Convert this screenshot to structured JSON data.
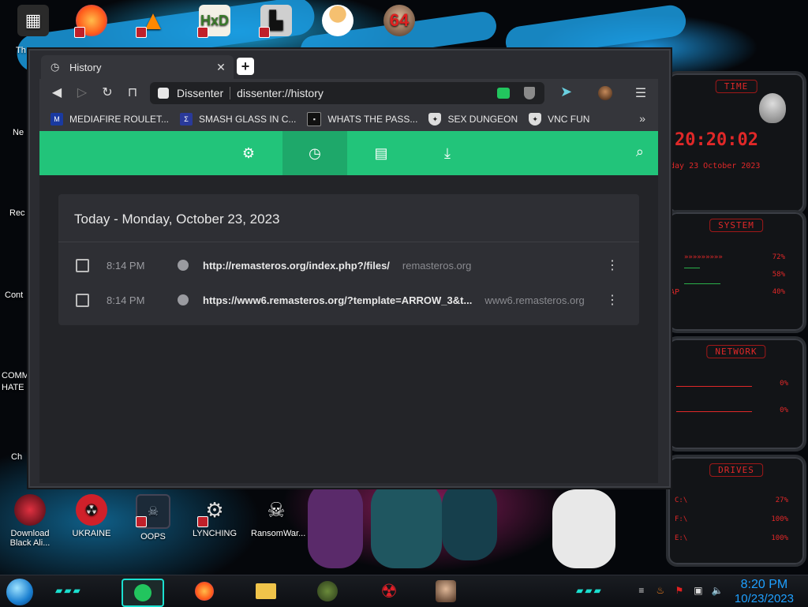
{
  "desktop": {
    "top_icons": [
      {
        "name": "tiles",
        "color": "#c0392b"
      },
      {
        "name": "firefox",
        "color": "#ff7a1a"
      },
      {
        "name": "vlc",
        "color": "#ff8800"
      },
      {
        "name": "hxd",
        "color": "#6ab04c"
      },
      {
        "name": "maze",
        "color": "#222222"
      },
      {
        "name": "doctor",
        "color": "#f0a030"
      },
      {
        "name": "portrait-64",
        "color": "#b08060"
      }
    ],
    "partial_labels": [
      "Th",
      "Ne",
      "Rec",
      "Cont",
      "COMM",
      "HATE",
      "Ch"
    ],
    "bottom_icons": [
      {
        "label": "Download Black Ali...",
        "color": "#8a1020"
      },
      {
        "label": "UKRAINE",
        "color": "#d0202a"
      },
      {
        "label": "OOPS",
        "color": "#203040"
      },
      {
        "label": "LYNCHING",
        "color": "#c0c0c0"
      },
      {
        "label": "RansomWar...",
        "color": "#ffffff"
      }
    ]
  },
  "widget": {
    "time_title": "TIME",
    "time_value": "20:20:02",
    "date_value": "day 23 October 2023",
    "system_title": "SYSTEM",
    "system_values": [
      "72%",
      "58%",
      "40%"
    ],
    "system_label": "AP",
    "network_title": "NETWORK",
    "network_values": [
      "0%",
      "0%"
    ],
    "drives_title": "DRIVES",
    "drives": [
      {
        "label": "C:\\",
        "value": "27%"
      },
      {
        "label": "F:\\",
        "value": "100%"
      },
      {
        "label": "E:\\",
        "value": "100%"
      }
    ],
    "accent": "#e02828"
  },
  "browser": {
    "tab_title": "History",
    "address": {
      "site_label": "Dissenter",
      "url": "dissenter://history"
    },
    "bookmarks": [
      {
        "label": "MEDIAFIRE ROULET...",
        "icon": "mediafire-icon"
      },
      {
        "label": "SMASH GLASS IN C...",
        "icon": "sigma-icon"
      },
      {
        "label": "WHATS THE PASS...",
        "icon": "terminal-icon"
      },
      {
        "label": "SEX DUNGEON",
        "icon": "shield-icon"
      },
      {
        "label": "VNC FUN",
        "icon": "shield-icon"
      }
    ],
    "more_bookmarks": "»",
    "accent": "#22c47a",
    "history": {
      "heading": "Today - Monday, October 23, 2023",
      "entries": [
        {
          "time": "8:14 PM",
          "url": "http://remasteros.org/index.php?/files/",
          "domain": "remasteros.org"
        },
        {
          "time": "8:14 PM",
          "url": "https://www6.remasteros.org/?template=ARROW_3&t...",
          "domain": "www6.remasteros.org"
        }
      ]
    }
  },
  "taskbar": {
    "clock_time": "8:20 PM",
    "clock_date": "10/23/2023",
    "clock_color": "#1ea0ff"
  }
}
